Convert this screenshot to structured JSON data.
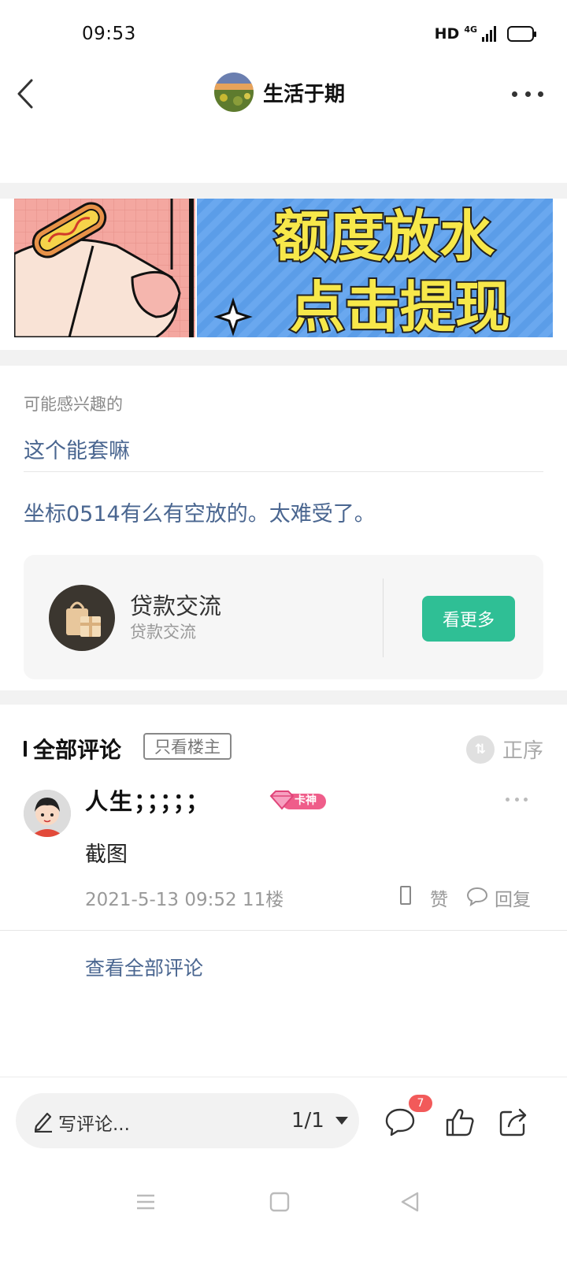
{
  "status_bar": {
    "time": "09:53",
    "hd": "HD",
    "network": "4G",
    "battery_color": "#f2c414"
  },
  "nav": {
    "title": "生活于期",
    "back_icon": "chevron-left-icon",
    "more_icon": "more-horizontal-icon"
  },
  "ad_banner": {
    "line1": "额度放水",
    "line2": "点击提现",
    "bg_color": "#5b9de8",
    "text_color": "#f7e84a"
  },
  "recommend": {
    "section_label": "可能感兴趣的",
    "link1": "这个能套嘛",
    "link2": "坐标0514有么有空放的。太难受了。"
  },
  "forum_card": {
    "name": "贷款交流",
    "subtitle": "贷款交流",
    "button_label": "看更多",
    "button_color": "#2fbf95"
  },
  "comments": {
    "title": "全部评论",
    "filter_label": "只看楼主",
    "sort_label": "正序",
    "items": [
      {
        "user": "人生；；；；；",
        "badge_label": "卡神",
        "text": "截图",
        "meta": "2021-5-13 09:52  11楼",
        "like_label": "赞",
        "reply_label": "回复"
      }
    ],
    "view_all": "查看全部评论"
  },
  "bottom_bar": {
    "placeholder": "写评论...",
    "page_indicator": "1/1",
    "comment_count": "7",
    "icons": [
      "comment-icon",
      "thumbs-up-icon",
      "share-icon"
    ]
  },
  "colors": {
    "link": "#4a6690",
    "accent_green": "#2fbf95",
    "badge_red": "#f25a5a",
    "band_gray": "#f2f2f2"
  }
}
